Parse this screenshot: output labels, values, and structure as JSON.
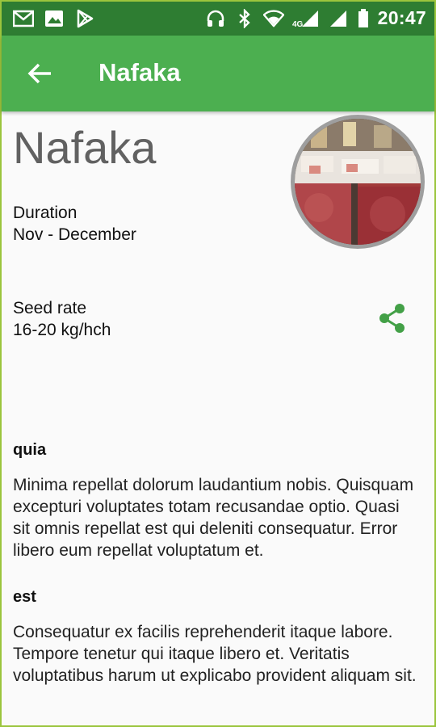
{
  "status_bar": {
    "time": "20:47",
    "network": "4G",
    "icons": [
      "gmail-icon",
      "gallery-icon",
      "play-store-icon",
      "headset-icon",
      "bluetooth-icon",
      "wifi-icon",
      "signal-icon",
      "battery-icon"
    ]
  },
  "app_bar": {
    "title": "Nafaka",
    "back_icon": "arrow-left-icon"
  },
  "crop": {
    "name": "Nafaka",
    "duration_label": "Duration",
    "duration_value": "Nov - December",
    "seed_rate_label": "Seed rate",
    "seed_rate_value": "16-20 kg/hch",
    "share_icon": "share-icon"
  },
  "sections": [
    {
      "title": "quia",
      "body": "Minima repellat dolorum laudantium nobis. Quisquam excepturi voluptates totam recusandae optio. Quasi sit omnis repellat est qui deleniti consequatur. Error libero eum repellat voluptatum et."
    },
    {
      "title": "est",
      "body": "Consequatur ex facilis reprehenderit itaque labore. Tempore tenetur qui itaque libero et. Veritatis voluptatibus harum ut explicabo provident aliquam sit."
    }
  ],
  "colors": {
    "status_bar": "#2e7d32",
    "app_bar": "#4caf50",
    "share": "#43a047"
  }
}
